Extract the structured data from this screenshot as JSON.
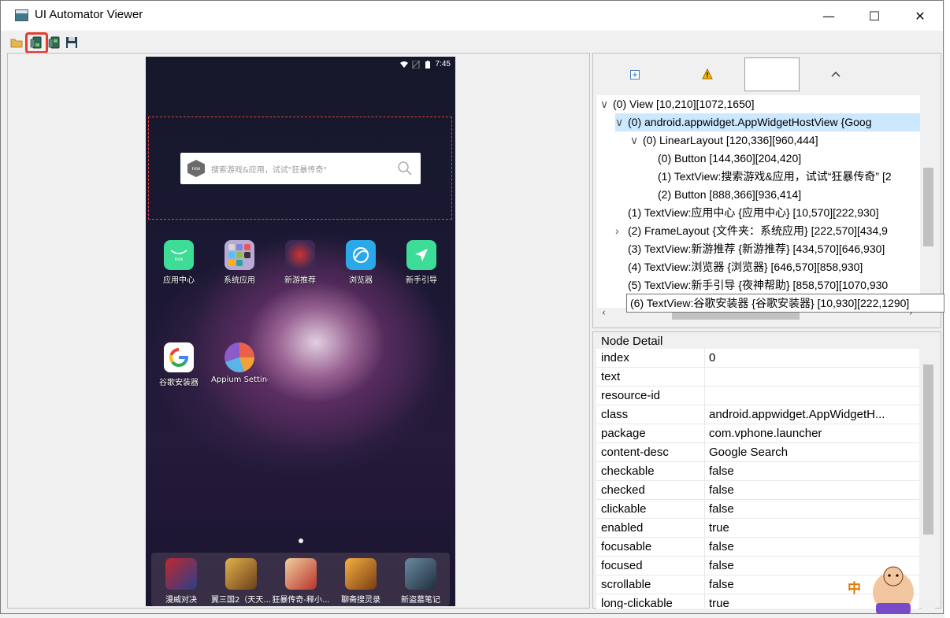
{
  "window": {
    "title": "UI Automator Viewer",
    "controls": {
      "minimize": "—",
      "maximize": "☐",
      "close": "✕"
    }
  },
  "toolbar": {
    "icons": [
      "open-folder-icon",
      "device-screenshot-icon",
      "device-screenshot-compressed-icon",
      "save-icon"
    ]
  },
  "phone": {
    "status_time": "7:45",
    "search_placeholder": "搜索游戏&应用，试试\"狂暴传奇\"",
    "search_logo": "nox",
    "apps_row1": [
      {
        "label": "应用中心",
        "icon": "nox-app-center-icon",
        "color": "#3ddc97"
      },
      {
        "label": "系统应用",
        "icon": "folder-icon",
        "color": "#b9a9d6"
      },
      {
        "label": "新游推荐",
        "icon": "marvel-game-icon",
        "color": "#8b2a2a"
      },
      {
        "label": "浏览器",
        "icon": "browser-icon",
        "color": "#2aa8e8"
      },
      {
        "label": "新手引导",
        "icon": "guide-arrow-icon",
        "color": "#3ddc97"
      }
    ],
    "apps_row2": [
      {
        "label": "谷歌安装器",
        "icon": "google-g-icon",
        "color": "#ffffff"
      },
      {
        "label": "Appium Settings",
        "icon": "appium-icon",
        "color": "#7c5cc4"
      }
    ],
    "dock": [
      {
        "label": "漫威对决",
        "icon": "marvel-duel-icon",
        "color": "#3a3a78"
      },
      {
        "label": "翼三国2（天天...",
        "icon": "sanguo-game-icon",
        "color": "#c9903a"
      },
      {
        "label": "狂暴传奇-释小...",
        "icon": "chuanqi-game-icon",
        "color": "#b8322a"
      },
      {
        "label": "聊斋搜灵录",
        "icon": "liaozhai-game-icon",
        "color": "#e08a2a"
      },
      {
        "label": "新盗墓笔记",
        "icon": "daomu-game-icon",
        "color": "#3a5468"
      }
    ]
  },
  "tree": {
    "nodes": [
      {
        "text": "(0) View [10,210][1072,1650]",
        "chev": "∨",
        "indent": 0,
        "selected": false
      },
      {
        "text": "(0) android.appwidget.AppWidgetHostView {Goog",
        "chev": "∨",
        "indent": 1,
        "selected": true
      },
      {
        "text": "(0) LinearLayout [120,336][960,444]",
        "chev": "∨",
        "indent": 2,
        "selected": false
      },
      {
        "text": "(0) Button [144,360][204,420]",
        "chev": "",
        "indent": 3,
        "selected": false
      },
      {
        "text": "(1) TextView:搜索游戏&应用，试试“狂暴传奇” [2",
        "chev": "",
        "indent": 3,
        "selected": false
      },
      {
        "text": "(2) Button [888,366][936,414]",
        "chev": "",
        "indent": 3,
        "selected": false
      },
      {
        "text": "(1) TextView:应用中心 {应用中心} [10,570][222,930]",
        "chev": "",
        "indent": 1,
        "selected": false
      },
      {
        "text": "(2) FrameLayout {文件夹：系统应用} [222,570][434,9",
        "chev": "›",
        "indent": 1,
        "selected": false
      },
      {
        "text": "(3) TextView:新游推荐 {新游推荐} [434,570][646,930]",
        "chev": "",
        "indent": 1,
        "selected": false
      },
      {
        "text": "(4) TextView:浏览器 {浏览器} [646,570][858,930]",
        "chev": "",
        "indent": 1,
        "selected": false
      },
      {
        "text": "(5) TextView:新手引导 {夜神帮助} [858,570][1070,930",
        "chev": "",
        "indent": 1,
        "selected": false
      }
    ],
    "tooltip": "(6) TextView:谷歌安装器 {谷歌安装器} [10,930][222,1290]"
  },
  "node_detail": {
    "header": "Node Detail",
    "rows": [
      {
        "key": "index",
        "value": "0"
      },
      {
        "key": "text",
        "value": ""
      },
      {
        "key": "resource-id",
        "value": ""
      },
      {
        "key": "class",
        "value": "android.appwidget.AppWidgetH..."
      },
      {
        "key": "package",
        "value": "com.vphone.launcher"
      },
      {
        "key": "content-desc",
        "value": "Google Search"
      },
      {
        "key": "checkable",
        "value": "false"
      },
      {
        "key": "checked",
        "value": "false"
      },
      {
        "key": "clickable",
        "value": "false"
      },
      {
        "key": "enabled",
        "value": "true"
      },
      {
        "key": "focusable",
        "value": "false"
      },
      {
        "key": "focused",
        "value": "false"
      },
      {
        "key": "scrollable",
        "value": "false"
      },
      {
        "key": "long-clickable",
        "value": "true"
      }
    ]
  },
  "ime": {
    "label": "中"
  }
}
